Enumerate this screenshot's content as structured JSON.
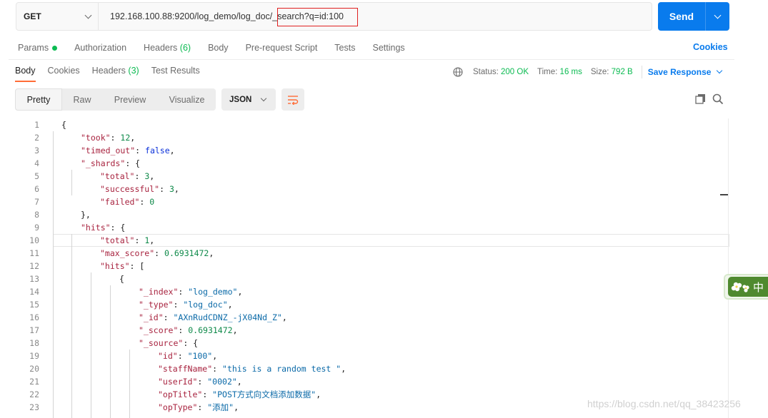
{
  "request": {
    "method": "GET",
    "url": "192.168.100.88:9200/log_demo/log_doc/_search?q=id:100",
    "send_label": "Send"
  },
  "request_tabs": {
    "params": "Params",
    "authorization": "Authorization",
    "headers": "Headers",
    "headers_count": "(6)",
    "body": "Body",
    "pre_request": "Pre-request Script",
    "tests": "Tests",
    "settings": "Settings",
    "cookies": "Cookies"
  },
  "response_tabs": {
    "body": "Body",
    "cookies": "Cookies",
    "headers": "Headers",
    "headers_count": "(3)",
    "test_results": "Test Results"
  },
  "status": {
    "status_label": "Status:",
    "status_value": "200 OK",
    "time_label": "Time:",
    "time_value": "16 ms",
    "size_label": "Size:",
    "size_value": "792 B",
    "save_response": "Save Response"
  },
  "view_modes": {
    "pretty": "Pretty",
    "raw": "Raw",
    "preview": "Preview",
    "visualize": "Visualize",
    "format": "JSON"
  },
  "code_lines": [
    {
      "n": "1",
      "indent": 0,
      "parts": [
        [
          "p",
          "{"
        ]
      ]
    },
    {
      "n": "2",
      "indent": 1,
      "parts": [
        [
          "k",
          "\"took\""
        ],
        [
          "p",
          ": "
        ],
        [
          "n",
          "12"
        ],
        [
          "p",
          ","
        ]
      ]
    },
    {
      "n": "3",
      "indent": 1,
      "parts": [
        [
          "k",
          "\"timed_out\""
        ],
        [
          "p",
          ": "
        ],
        [
          "b",
          "false"
        ],
        [
          "p",
          ","
        ]
      ]
    },
    {
      "n": "4",
      "indent": 1,
      "parts": [
        [
          "k",
          "\"_shards\""
        ],
        [
          "p",
          ": {"
        ]
      ]
    },
    {
      "n": "5",
      "indent": 2,
      "parts": [
        [
          "k",
          "\"total\""
        ],
        [
          "p",
          ": "
        ],
        [
          "n",
          "3"
        ],
        [
          "p",
          ","
        ]
      ]
    },
    {
      "n": "6",
      "indent": 2,
      "parts": [
        [
          "k",
          "\"successful\""
        ],
        [
          "p",
          ": "
        ],
        [
          "n",
          "3"
        ],
        [
          "p",
          ","
        ]
      ]
    },
    {
      "n": "7",
      "indent": 2,
      "parts": [
        [
          "k",
          "\"failed\""
        ],
        [
          "p",
          ": "
        ],
        [
          "n",
          "0"
        ]
      ]
    },
    {
      "n": "8",
      "indent": 1,
      "parts": [
        [
          "p",
          "},"
        ]
      ]
    },
    {
      "n": "9",
      "indent": 1,
      "parts": [
        [
          "k",
          "\"hits\""
        ],
        [
          "p",
          ": {"
        ]
      ]
    },
    {
      "n": "10",
      "indent": 2,
      "parts": [
        [
          "k",
          "\"total\""
        ],
        [
          "p",
          ": "
        ],
        [
          "n",
          "1"
        ],
        [
          "p",
          ","
        ]
      ]
    },
    {
      "n": "11",
      "indent": 2,
      "parts": [
        [
          "k",
          "\"max_score\""
        ],
        [
          "p",
          ": "
        ],
        [
          "n",
          "0.6931472"
        ],
        [
          "p",
          ","
        ]
      ]
    },
    {
      "n": "12",
      "indent": 2,
      "parts": [
        [
          "k",
          "\"hits\""
        ],
        [
          "p",
          ": ["
        ]
      ]
    },
    {
      "n": "13",
      "indent": 3,
      "parts": [
        [
          "p",
          "{"
        ]
      ]
    },
    {
      "n": "14",
      "indent": 4,
      "parts": [
        [
          "k",
          "\"_index\""
        ],
        [
          "p",
          ": "
        ],
        [
          "s",
          "\"log_demo\""
        ],
        [
          "p",
          ","
        ]
      ]
    },
    {
      "n": "15",
      "indent": 4,
      "parts": [
        [
          "k",
          "\"_type\""
        ],
        [
          "p",
          ": "
        ],
        [
          "s",
          "\"log_doc\""
        ],
        [
          "p",
          ","
        ]
      ]
    },
    {
      "n": "16",
      "indent": 4,
      "parts": [
        [
          "k",
          "\"_id\""
        ],
        [
          "p",
          ": "
        ],
        [
          "s",
          "\"AXnRudCDNZ_-jX04Nd_Z\""
        ],
        [
          "p",
          ","
        ]
      ]
    },
    {
      "n": "17",
      "indent": 4,
      "parts": [
        [
          "k",
          "\"_score\""
        ],
        [
          "p",
          ": "
        ],
        [
          "n",
          "0.6931472"
        ],
        [
          "p",
          ","
        ]
      ]
    },
    {
      "n": "18",
      "indent": 4,
      "parts": [
        [
          "k",
          "\"_source\""
        ],
        [
          "p",
          ": {"
        ]
      ]
    },
    {
      "n": "19",
      "indent": 5,
      "parts": [
        [
          "k",
          "\"id\""
        ],
        [
          "p",
          ": "
        ],
        [
          "s",
          "\"100\""
        ],
        [
          "p",
          ","
        ]
      ]
    },
    {
      "n": "20",
      "indent": 5,
      "parts": [
        [
          "k",
          "\"staffName\""
        ],
        [
          "p",
          ": "
        ],
        [
          "s",
          "\"this is a random test \""
        ],
        [
          "p",
          ","
        ]
      ]
    },
    {
      "n": "21",
      "indent": 5,
      "parts": [
        [
          "k",
          "\"userId\""
        ],
        [
          "p",
          ": "
        ],
        [
          "s",
          "\"0002\""
        ],
        [
          "p",
          ","
        ]
      ]
    },
    {
      "n": "22",
      "indent": 5,
      "parts": [
        [
          "k",
          "\"opTitle\""
        ],
        [
          "p",
          ": "
        ],
        [
          "s",
          "\"POST方式向文档添加数据\""
        ],
        [
          "p",
          ","
        ]
      ]
    },
    {
      "n": "23",
      "indent": 5,
      "parts": [
        [
          "k",
          "\"opType\""
        ],
        [
          "p",
          ": "
        ],
        [
          "s",
          "\"添加\""
        ],
        [
          "p",
          ","
        ]
      ]
    }
  ],
  "widget": {
    "text": "中"
  },
  "watermark": "https://blog.csdn.net/qq_38423256",
  "colors": {
    "accent": "#097bed",
    "status_ok": "#0cbb52",
    "active_tab": "#ff6c37",
    "url_highlight": "#e02020"
  }
}
